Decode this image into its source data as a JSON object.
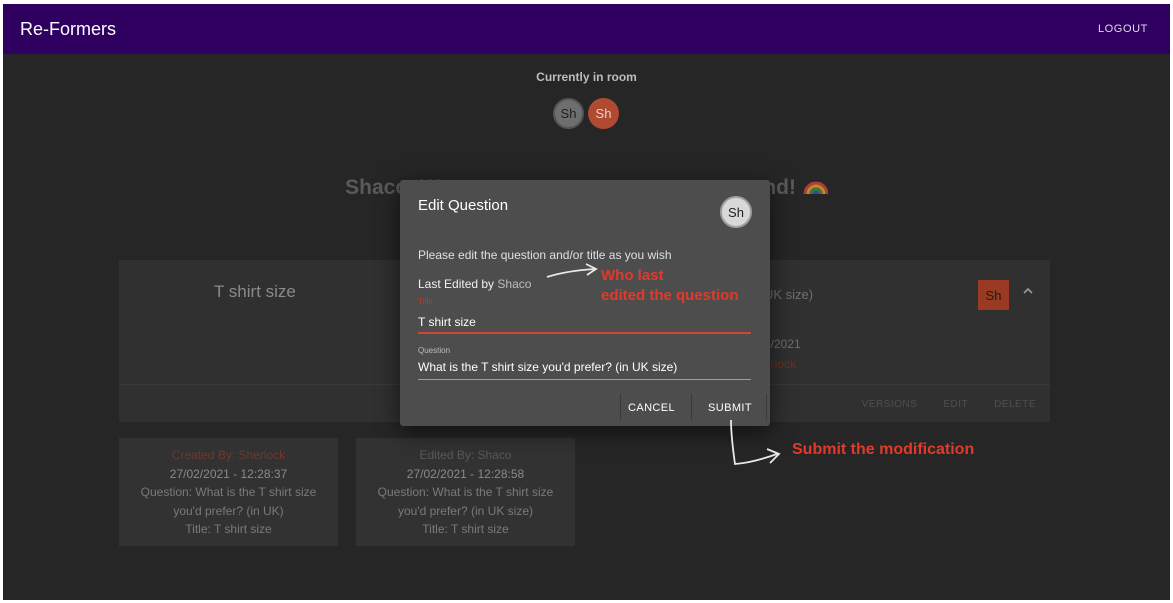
{
  "app": {
    "title": "Re-Formers",
    "logout_label": "LOGOUT"
  },
  "room": {
    "label": "Currently in room",
    "avatars": [
      {
        "initials": "Sh",
        "color": "#6e6e6e"
      },
      {
        "initials": "Sh",
        "color": "#b04a30"
      }
    ]
  },
  "welcome": {
    "left_text": "Shaco, W",
    "right_text": "ound!",
    "emoji_icon": "rainbow-icon"
  },
  "question_card": {
    "title": "T shirt size",
    "question_tail": "UK size)",
    "date_tail": "2/2021",
    "author_tail": "erlock",
    "avatar_initials": "Sh",
    "collapse_icon": "chevron-up-icon",
    "actions": [
      "VERSIONS",
      "EDIT",
      "DELETE"
    ]
  },
  "versions": [
    {
      "by": "Created By: Sherlock",
      "timestamp": "27/02/2021 - 12:28:37",
      "question": "Question: What is the T shirt size you'd prefer? (in UK)",
      "title": "Title: T shirt size"
    },
    {
      "by": "Edited By: Shaco",
      "timestamp": "27/02/2021 - 12:28:58",
      "question": "Question: What is the T shirt size you'd prefer? (in UK size)",
      "title": "Title: T shirt size"
    }
  ],
  "dialog": {
    "title": "Edit Question",
    "avatar_initials": "Sh",
    "instructions": "Please edit the question and/or title as you wish",
    "last_edited_prefix": "Last Edited by",
    "last_edited_user": "Shaco",
    "title_field": {
      "label": "Title",
      "value": "T shirt size"
    },
    "question_field": {
      "label": "Question",
      "value": "What is the T shirt size you'd prefer? (in UK size)"
    },
    "cancel_label": "CANCEL",
    "submit_label": "SUBMIT"
  },
  "annotations": {
    "who_line1": "Who last",
    "who_line2": "edited the question",
    "submit": "Submit the modification",
    "color": "#e23a2a"
  }
}
